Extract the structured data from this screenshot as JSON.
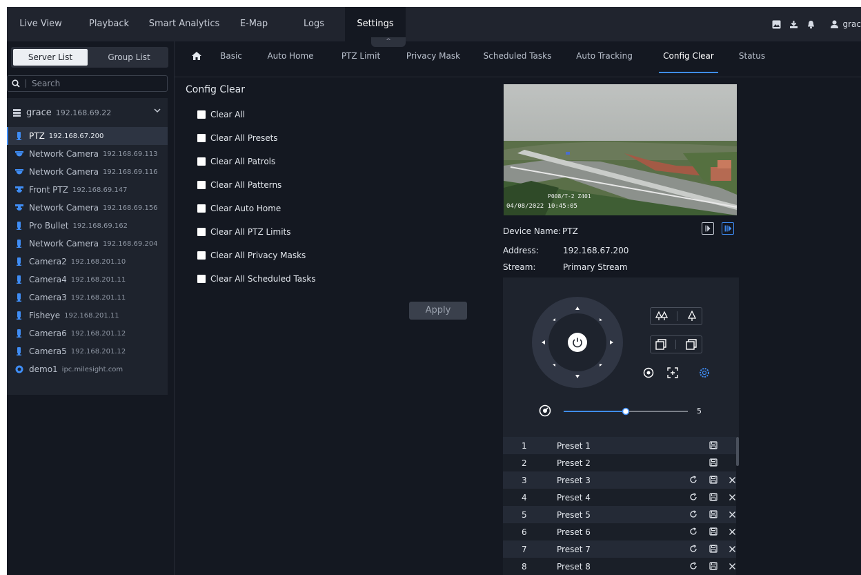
{
  "topnav": {
    "tabs": [
      "Live View",
      "Playback",
      "Smart Analytics",
      "E-Map",
      "Logs",
      "Settings"
    ],
    "active_tab": "Settings",
    "user": "grac"
  },
  "sidebar": {
    "tabs": [
      "Server List",
      "Group List"
    ],
    "search_placeholder": "Search",
    "server": {
      "name": "grace",
      "ip": "192.168.69.22"
    },
    "devices": [
      {
        "name": "PTZ",
        "ip": "192.168.67.200",
        "icon": "ptz-dome-icon",
        "active": true
      },
      {
        "name": "Network Camera",
        "ip": "192.168.69.113",
        "icon": "dome-camera-icon"
      },
      {
        "name": "Network Camera",
        "ip": "192.168.69.116",
        "icon": "dome-camera-icon"
      },
      {
        "name": "Front PTZ",
        "ip": "192.168.69.147",
        "icon": "speed-dome-icon"
      },
      {
        "name": "Network Camera",
        "ip": "192.168.69.156",
        "icon": "speed-dome-icon"
      },
      {
        "name": "Pro Bullet",
        "ip": "192.168.69.162",
        "icon": "bullet-camera-icon"
      },
      {
        "name": "Network Camera",
        "ip": "192.168.69.204",
        "icon": "bullet-camera-icon"
      },
      {
        "name": "Camera2",
        "ip": "192.168.201.10",
        "icon": "bullet-camera-icon"
      },
      {
        "name": "Camera4",
        "ip": "192.168.201.11",
        "icon": "bullet-camera-icon"
      },
      {
        "name": "Camera3",
        "ip": "192.168.201.11",
        "icon": "bullet-camera-icon"
      },
      {
        "name": "Fisheye",
        "ip": "192.168.201.11",
        "icon": "bullet-camera-icon"
      },
      {
        "name": "Camera6",
        "ip": "192.168.201.12",
        "icon": "bullet-camera-icon"
      },
      {
        "name": "Camera5",
        "ip": "192.168.201.12",
        "icon": "bullet-camera-icon"
      },
      {
        "name": "demo1",
        "ip": "ipc.milesight.com",
        "icon": "cloud-camera-icon"
      }
    ]
  },
  "subtabs": {
    "items": [
      "Basic",
      "Auto Home",
      "PTZ Limit",
      "Privacy Mask",
      "Scheduled Tasks",
      "Auto Tracking",
      "Config Clear",
      "Status"
    ],
    "active": "Config Clear"
  },
  "config_clear": {
    "title": "Config Clear",
    "options": [
      "Clear All",
      "Clear All Presets",
      "Clear All Patrols",
      "Clear All Patterns",
      "Clear Auto Home",
      "Clear All PTZ Limits",
      "Clear All Privacy Masks",
      "Clear All Scheduled Tasks"
    ],
    "apply_label": "Apply"
  },
  "video": {
    "osd_line1": "P008/T-2  Z401",
    "osd_line2": "04/08/2022 10:45:05"
  },
  "device_info": {
    "name_label": "Device Name:",
    "name_value": "PTZ",
    "address_label": "Address:",
    "address_value": "192.168.67.200",
    "stream_label": "Stream:",
    "stream_value": "Primary Stream"
  },
  "ptz": {
    "speed_value": 5,
    "speed_max": 10,
    "speed_display": "5"
  },
  "presets": [
    {
      "num": "1",
      "name": "Preset 1",
      "configured": false
    },
    {
      "num": "2",
      "name": "Preset 2",
      "configured": false
    },
    {
      "num": "3",
      "name": "Preset 3",
      "configured": true
    },
    {
      "num": "4",
      "name": "Preset 4",
      "configured": true
    },
    {
      "num": "5",
      "name": "Preset 5",
      "configured": true
    },
    {
      "num": "6",
      "name": "Preset 6",
      "configured": true
    },
    {
      "num": "7",
      "name": "Preset 7",
      "configured": true
    },
    {
      "num": "8",
      "name": "Preset 8",
      "configured": true
    }
  ],
  "colors": {
    "accent": "#3f8df5",
    "background": "#141821",
    "panel": "#1e232d"
  }
}
